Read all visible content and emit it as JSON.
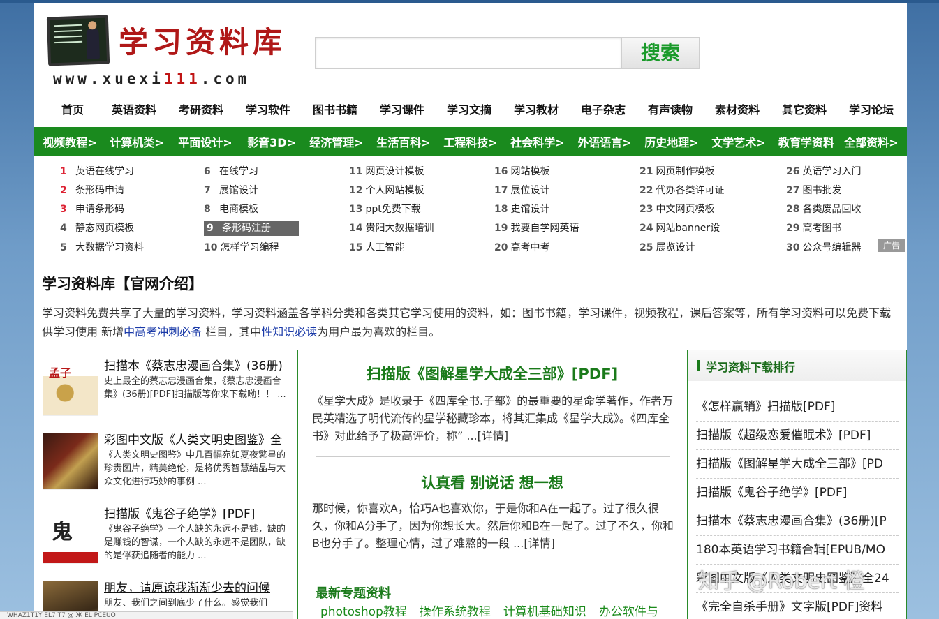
{
  "header": {
    "logo_title": "学习资料库",
    "logo_url_prefix": "www.xuexi",
    "logo_url_num": "111",
    "logo_url_suffix": ".com",
    "search_button": "搜索",
    "search_placeholder": ""
  },
  "mainnav": [
    "首页",
    "英语资料",
    "考研资料",
    "学习软件",
    "图书书籍",
    "学习课件",
    "学习文摘",
    "学习教材",
    "电子杂志",
    "有声读物",
    "素材资料",
    "其它资料",
    "学习论坛"
  ],
  "catbar": [
    "视频教程>",
    "计算机类>",
    "平面设计>",
    "影音3D>",
    "经济管理>",
    "生活百科>",
    "工程科技>",
    "社会科学>",
    "外语语言>",
    "历史地理>",
    "文学艺术>",
    "教育学资料",
    "全部资料>"
  ],
  "links": [
    {
      "n": "1",
      "t": "英语在线学习"
    },
    {
      "n": "2",
      "t": "条形码申请"
    },
    {
      "n": "3",
      "t": "申请条形码"
    },
    {
      "n": "4",
      "t": "静态网页模板"
    },
    {
      "n": "5",
      "t": "大数据学习资料"
    },
    {
      "n": "6",
      "t": "在线学习"
    },
    {
      "n": "7",
      "t": "展馆设计"
    },
    {
      "n": "8",
      "t": "电商模板"
    },
    {
      "n": "9",
      "t": "条形码注册"
    },
    {
      "n": "10",
      "t": "怎样学习编程"
    },
    {
      "n": "11",
      "t": "网页设计模板"
    },
    {
      "n": "12",
      "t": "个人网站模板"
    },
    {
      "n": "13",
      "t": "ppt免费下载"
    },
    {
      "n": "14",
      "t": "贵阳大数据培训"
    },
    {
      "n": "15",
      "t": "人工智能"
    },
    {
      "n": "16",
      "t": "网站模板"
    },
    {
      "n": "17",
      "t": "展位设计"
    },
    {
      "n": "18",
      "t": "史馆设计"
    },
    {
      "n": "19",
      "t": "我要自学网英语"
    },
    {
      "n": "20",
      "t": "高考中考"
    },
    {
      "n": "21",
      "t": "网页制作模板"
    },
    {
      "n": "22",
      "t": "代办各类许可证"
    },
    {
      "n": "23",
      "t": "中文网页模板"
    },
    {
      "n": "24",
      "t": "网站banner设"
    },
    {
      "n": "25",
      "t": "展览设计"
    },
    {
      "n": "26",
      "t": "英语学习入门"
    },
    {
      "n": "27",
      "t": "图书批发"
    },
    {
      "n": "28",
      "t": "各类废品回收"
    },
    {
      "n": "29",
      "t": "高考图书"
    },
    {
      "n": "30",
      "t": "公众号编辑器"
    }
  ],
  "ad_label": "广告",
  "intro": {
    "title": "学习资料库【官网介绍】",
    "text_a": "学习资料免费共享了大量的学习资料，学习资料涵盖各学科分类和各类其它学习使用的资料，如：图书书籍，学习课件，视频教程，课后答案等，所有学习资料可以免费下载供学习使用 新增",
    "link1": "中高考冲刺必备",
    "text_b": " 栏目，其中",
    "link2": "性知识必读",
    "text_c": "为用户最为喜欢的栏目。"
  },
  "books": [
    {
      "title": "扫描本《蔡志忠漫画合集》(36册)",
      "desc": "史上最全的蔡志忠漫画合集，《蔡志忠漫画合集》(36册)[PDF]扫描版等你来下载呦！！ ..."
    },
    {
      "title": "彩图中文版《人类文明史图鉴》全",
      "desc": "《人类文明史图鉴》中几百幅宛如夏夜繁星的珍贵图片，精美绝伦，是将优秀智慧结晶与大众文化进行巧妙的事例 ..."
    },
    {
      "title": "扫描版《鬼谷子绝学》[PDF]",
      "desc": "《鬼谷子绝学》一个人缺的永远不是钱，缺的是赚钱的智谋，一个人缺的永远不是团队，缺的是俘获追随者的能力 ..."
    },
    {
      "title": "朋友，请原谅我渐渐少去的问候",
      "desc": "朋友、我们之间到底少了什么。感觉我们"
    }
  ],
  "features": [
    {
      "title": "扫描版《图解星学大成全三部》[PDF]",
      "text": "《星学大成》是收录于《四库全书.子部》的最重要的星命学著作，作者万民英精选了明代流传的星学秘藏珍本，将其汇集成《星学大成》。《四库全书》对此给予了极高评价，称” ...[详情]"
    },
    {
      "title": "认真看 别说话 想一想",
      "text": "那时候，你喜欢A，恰巧A也喜欢你，于是你和A在一起了。过了很久很久，你和A分手了，因为你想长大。然后你和B在一起了。过了不久，你和B也分手了。整理心情，过了难熬的一段 ...[详情]"
    }
  ],
  "topics": {
    "title": "最新专题资料",
    "items": [
      "photoshop教程",
      "操作系统教程",
      "计算机基础知识",
      "办公软件与"
    ]
  },
  "ranking": {
    "title": "学习资料下载排行",
    "items": [
      "《怎样赢销》扫描版[PDF]",
      "扫描版《超级恋爱催眠术》[PDF]",
      "扫描版《图解星学大成全三部》[PD",
      "扫描版《鬼谷子绝学》[PDF]",
      "扫描本《蔡志忠漫画合集》(36册)[P",
      "180本英语学习书籍合辑[EPUB/MO",
      "彩图中文版《人类文明史图鉴》全24",
      "《完全自杀手册》文字版[PDF]资料"
    ]
  },
  "watermark": "知乎 @Robert 橙",
  "status_text": "WHAZ1T1Y  EL7  T7  @  Ж  EL PCEUO"
}
